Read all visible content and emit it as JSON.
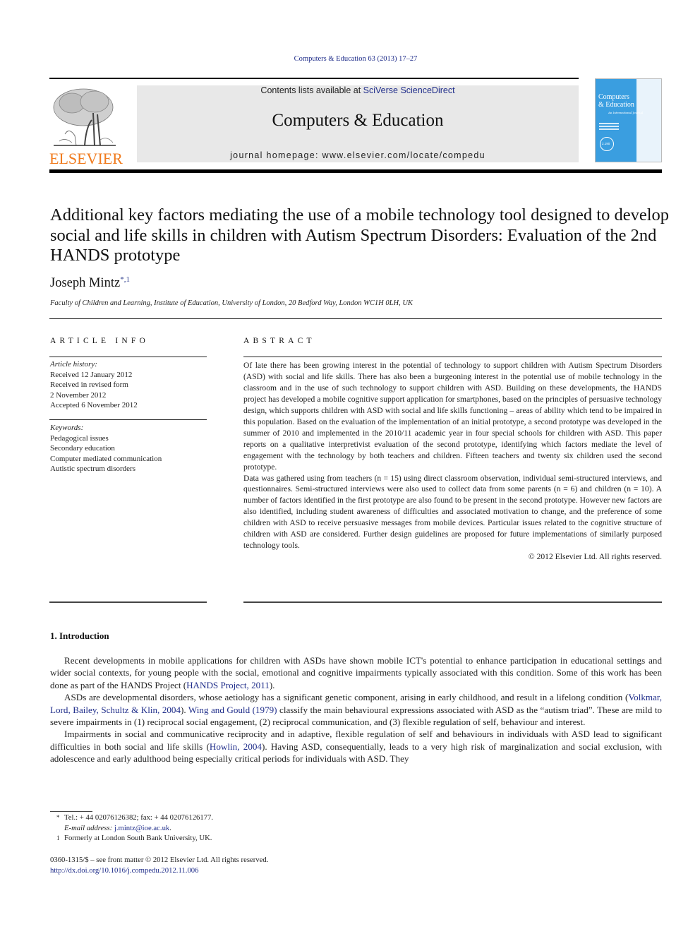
{
  "header": {
    "journal_ref": "Computers & Education 63 (2013) 17–27",
    "contents_prefix": "Contents lists available at ",
    "contents_link": "SciVerse ScienceDirect",
    "journal_title": "Computers & Education",
    "homepage_prefix": "journal homepage: ",
    "homepage_url": "www.elsevier.com/locate/compedu",
    "publisher_logo_text": "ELSEVIER",
    "cover": {
      "title_line1": "Computers",
      "title_line2": "& Education",
      "subtitle": "An International Journal",
      "badge": "2.190"
    },
    "colors": {
      "publisher_orange": "#f07b1e",
      "link_blue": "#1f2d8a",
      "banner_gray": "#e8e8e8",
      "cover_blue": "#3a9ee0"
    }
  },
  "article": {
    "title": "Additional key factors mediating the use of a mobile technology tool designed to develop social and life skills in children with Autism Spectrum Disorders: Evaluation of the 2nd HANDS prototype",
    "author": "Joseph Mintz",
    "author_marks": "*,1",
    "affiliation": "Faculty of Children and Learning, Institute of Education, University of London, 20 Bedford Way, London WC1H 0LH, UK"
  },
  "article_info": {
    "heading": "ARTICLE INFO",
    "history_label": "Article history:",
    "history": [
      "Received 12 January 2012",
      "Received in revised form",
      "2 November 2012",
      "Accepted 6 November 2012"
    ],
    "keywords_label": "Keywords:",
    "keywords": [
      "Pedagogical issues",
      "Secondary education",
      "Computer mediated communication",
      "Autistic spectrum disorders"
    ]
  },
  "abstract": {
    "heading": "ABSTRACT",
    "paragraphs": [
      "Of late there has been growing interest in the potential of technology to support children with Autism Spectrum Disorders (ASD) with social and life skills. There has also been a burgeoning interest in the potential use of mobile technology in the classroom and in the use of such technology to support children with ASD. Building on these developments, the HANDS project has developed a mobile cognitive support application for smartphones, based on the principles of persuasive technology design, which supports children with ASD with social and life skills functioning – areas of ability which tend to be impaired in this population. Based on the evaluation of the implementation of an initial prototype, a second prototype was developed in the summer of 2010 and implemented in the 2010/11 academic year in four special schools for children with ASD. This paper reports on a qualitative interpretivist evaluation of the second prototype, identifying which factors mediate the level of engagement with the technology by both teachers and children. Fifteen teachers and twenty six children used the second prototype.",
      "Data was gathered using from teachers (n = 15) using direct classroom observation, individual semi-structured interviews, and questionnaires. Semi-structured interviews were also used to collect data from some parents (n = 6) and children (n = 10). A number of factors identified in the first prototype are also found to be present in the second prototype. However new factors are also identified, including student awareness of difficulties and associated motivation to change, and the preference of some children with ASD to receive persuasive messages from mobile devices. Particular issues related to the cognitive structure of children with ASD are considered. Further design guidelines are proposed for future implementations of similarly purposed technology tools."
    ],
    "copyright": "© 2012 Elsevier Ltd. All rights reserved."
  },
  "introduction": {
    "heading": "1.  Introduction",
    "p1_a": "Recent developments in mobile applications for children with ASDs have shown mobile ICT's potential to enhance participation in educational settings and wider social contexts, for young people with the social, emotional and cognitive impairments typically associated with this condition. Some of this work has been done as part of the HANDS Project (",
    "p1_cite": "HANDS Project, 2011",
    "p1_b": ").",
    "p2_a": "ASDs are developmental disorders, whose aetiology has a significant genetic component, arising in early childhood, and result in a lifelong condition (",
    "p2_cite1": "Volkmar, Lord, Bailey, Schultz & Klin, 2004",
    "p2_b": "). ",
    "p2_cite2": "Wing and Gould (1979)",
    "p2_c": " classify the main behavioural expressions associated with ASD as the “autism triad”. These are mild to severe impairments in (1) reciprocal social engagement, (2) reciprocal communication, and (3) flexible regulation of self, behaviour and interest.",
    "p3_a": "Impairments in social and communicative reciprocity and in adaptive, flexible regulation of self and behaviours in individuals with ASD lead to significant difficulties in both social and life skills (",
    "p3_cite": "Howlin, 2004",
    "p3_b": "). Having ASD, consequentially, leads to a very high risk of marginalization and social exclusion, with adolescence and early adulthood being especially critical periods for individuals with ASD. They"
  },
  "footnotes": {
    "star_mark": "*",
    "contact": "Tel.: + 44 02076126382; fax: + 44 02076126177.",
    "email_label": "E-mail address: ",
    "email": "j.mintz@ioe.ac.uk",
    "email_end": ".",
    "one_mark": "1",
    "formerly": "Formerly at London South Bank University, UK."
  },
  "front_matter": {
    "issn_line": "0360-1315/$ – see front matter © 2012 Elsevier Ltd. All rights reserved.",
    "doi": "http://dx.doi.org/10.1016/j.compedu.2012.11.006"
  }
}
